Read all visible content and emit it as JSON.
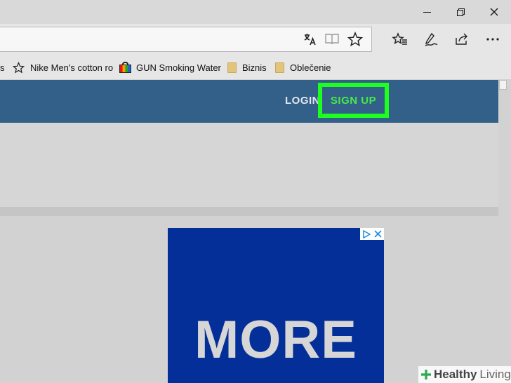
{
  "window": {
    "minimize_icon": "minimize-icon",
    "maximize_icon": "restore-icon",
    "close_icon": "close-icon"
  },
  "toolbar": {
    "icons": [
      "translate-icon",
      "reading-view-icon",
      "favorite-star-icon",
      "favorites-hub-icon",
      "pen-notes-icon",
      "share-icon",
      "more-icon"
    ]
  },
  "favorites": {
    "items": [
      {
        "label": "s",
        "icon": "star-icon"
      },
      {
        "label": "Nike Men's cotton ro",
        "icon": "star-icon"
      },
      {
        "label": "GUN Smoking Water",
        "icon": "shopping-bag-icon"
      },
      {
        "label": "Biznis",
        "icon": "folder-icon"
      },
      {
        "label": "Oblečenie",
        "icon": "folder-icon"
      }
    ]
  },
  "header": {
    "login_label": "LOGIN",
    "signup_label": "SIGN UP",
    "highlight_color": "#1fff1f",
    "header_color": "#336089"
  },
  "ad": {
    "headline": "MORE",
    "background": "#052f98",
    "badge_icons": [
      "adchoices-icon",
      "ad-close-icon"
    ]
  },
  "watermark": {
    "brand_bold": "Healthy",
    "brand_light": "Living",
    "icon": "plus-leaf-icon"
  }
}
